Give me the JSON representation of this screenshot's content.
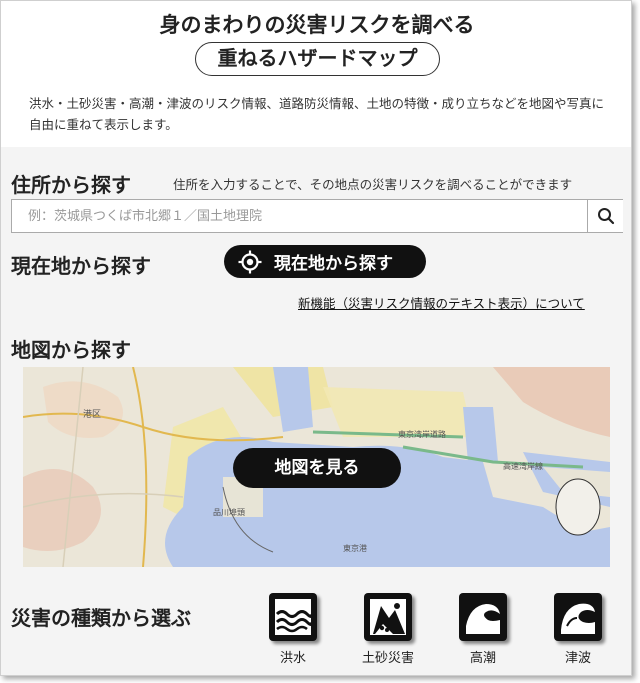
{
  "header": {
    "title": "身のまわりの災害リスクを調べる",
    "subtitle": "重ねるハザードマップ",
    "description": "洪水・土砂災害・高潮・津波のリスク情報、道路防災情報、土地の特徴・成り立ちなどを地図や写真に自由に重ねて表示します。"
  },
  "address": {
    "title": "住所から探す",
    "note": "住所を入力することで、その地点の災害リスクを調べることができます",
    "placeholder": "例：茨城県つくば市北郷１／国土地理院",
    "search_icon": "search-icon"
  },
  "current": {
    "title": "現在地から探す",
    "button_label": "現在地から探す",
    "button_icon": "crosshair-icon"
  },
  "new_feature_link": "新機能（災害リスク情報のテキスト表示）について",
  "map": {
    "title": "地図から探す",
    "button_label": "地図を見る",
    "labels": [
      "港区",
      "東京湾岸道路",
      "高速湾岸線",
      "東京港",
      "品川埠頭"
    ]
  },
  "disaster": {
    "title": "災害の種類から選ぶ",
    "items": [
      {
        "label": "洪水",
        "icon": "flood-icon"
      },
      {
        "label": "土砂災害",
        "icon": "landslide-icon"
      },
      {
        "label": "高潮",
        "icon": "storm-surge-icon"
      },
      {
        "label": "津波",
        "icon": "tsunami-icon"
      }
    ]
  }
}
